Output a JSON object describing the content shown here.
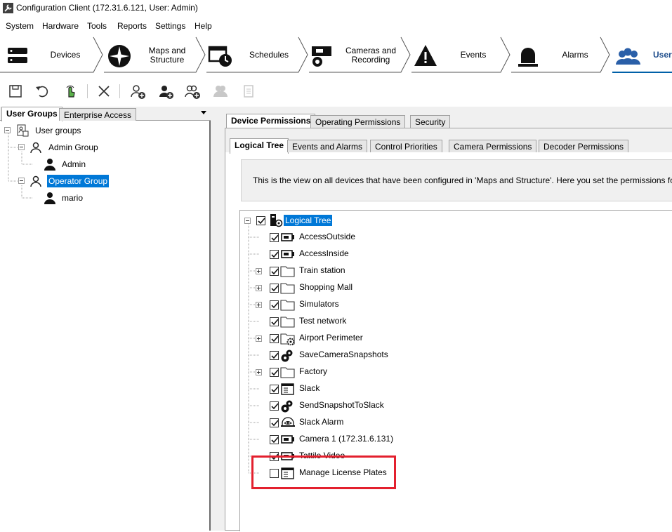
{
  "window": {
    "title": "Configuration Client (172.31.6.121, User: Admin)",
    "app_icon": "wrench-icon"
  },
  "menu": [
    "System",
    "Hardware",
    "Tools",
    "Reports",
    "Settings",
    "Help"
  ],
  "nav": {
    "items": [
      {
        "label": "Devices",
        "icon": "devices-icon"
      },
      {
        "label": "Maps and Structure",
        "icon": "maps-icon"
      },
      {
        "label": "Schedules",
        "icon": "schedules-icon"
      },
      {
        "label": "Cameras and Recording",
        "icon": "cameras-icon"
      },
      {
        "label": "Events",
        "icon": "events-icon"
      },
      {
        "label": "Alarms",
        "icon": "alarms-icon"
      },
      {
        "label": "User",
        "icon": "users-icon"
      }
    ],
    "active_index": 6,
    "active_color": "#0060a8"
  },
  "toolbar": [
    "save-icon",
    "undo-icon",
    "activate-icon",
    "delete-icon",
    "add-user-group-icon",
    "add-user-icon",
    "add-dual-auth-icon",
    "copy-icon-disabled",
    "report-icon-disabled"
  ],
  "left_panel": {
    "tabs": [
      "User Groups",
      "Enterprise Access"
    ],
    "tree": {
      "root": "User groups",
      "groups": [
        {
          "name": "Admin Group",
          "users": [
            "Admin"
          ],
          "selected": false
        },
        {
          "name": "Operator Group",
          "users": [
            "mario"
          ],
          "selected": true
        }
      ]
    }
  },
  "right_panel": {
    "tabs": [
      "Device Permissions",
      "Operating Permissions",
      "Security"
    ],
    "subtabs": [
      "Logical Tree",
      "Events and Alarms",
      "Control Priorities",
      "Camera Permissions",
      "Decoder Permissions"
    ],
    "info_text": "This is the view on all devices that have been configured in 'Maps and Structure'. Here you set the permissions for each d",
    "tree": {
      "root": {
        "label": "Logical Tree",
        "checked": true
      },
      "items": [
        {
          "label": "AccessOutside",
          "icon": "camera-icon",
          "checked": true,
          "expandable": false
        },
        {
          "label": "AccessInside",
          "icon": "camera-icon",
          "checked": true,
          "expandable": false
        },
        {
          "label": "Train station",
          "icon": "folder-icon",
          "checked": true,
          "expandable": true
        },
        {
          "label": "Shopping Mall",
          "icon": "folder-icon",
          "checked": true,
          "expandable": true
        },
        {
          "label": "Simulators",
          "icon": "folder-icon",
          "checked": true,
          "expandable": true
        },
        {
          "label": "Test network",
          "icon": "folder-icon",
          "checked": true,
          "expandable": false
        },
        {
          "label": "Airport Perimeter",
          "icon": "folder-gear-icon",
          "checked": true,
          "expandable": true
        },
        {
          "label": "SaveCameraSnapshots",
          "icon": "gears-icon",
          "checked": true,
          "expandable": false
        },
        {
          "label": "Factory",
          "icon": "folder-icon",
          "checked": true,
          "expandable": true
        },
        {
          "label": "Slack",
          "icon": "document-icon",
          "checked": true,
          "expandable": false
        },
        {
          "label": "SendSnapshotToSlack",
          "icon": "gears-icon",
          "checked": true,
          "expandable": false
        },
        {
          "label": "Slack Alarm",
          "icon": "alarm-eye-icon",
          "checked": true,
          "expandable": false
        },
        {
          "label": "Camera 1 (172.31.6.131)",
          "icon": "camera-icon",
          "checked": true,
          "expandable": false
        },
        {
          "label": "Tattile Video",
          "icon": "camera-icon",
          "checked": true,
          "expandable": false
        },
        {
          "label": "Manage License Plates",
          "icon": "document-icon",
          "checked": false,
          "expandable": false
        }
      ]
    }
  },
  "highlight_color": "#e3202e",
  "selection_color": "#0078d7"
}
